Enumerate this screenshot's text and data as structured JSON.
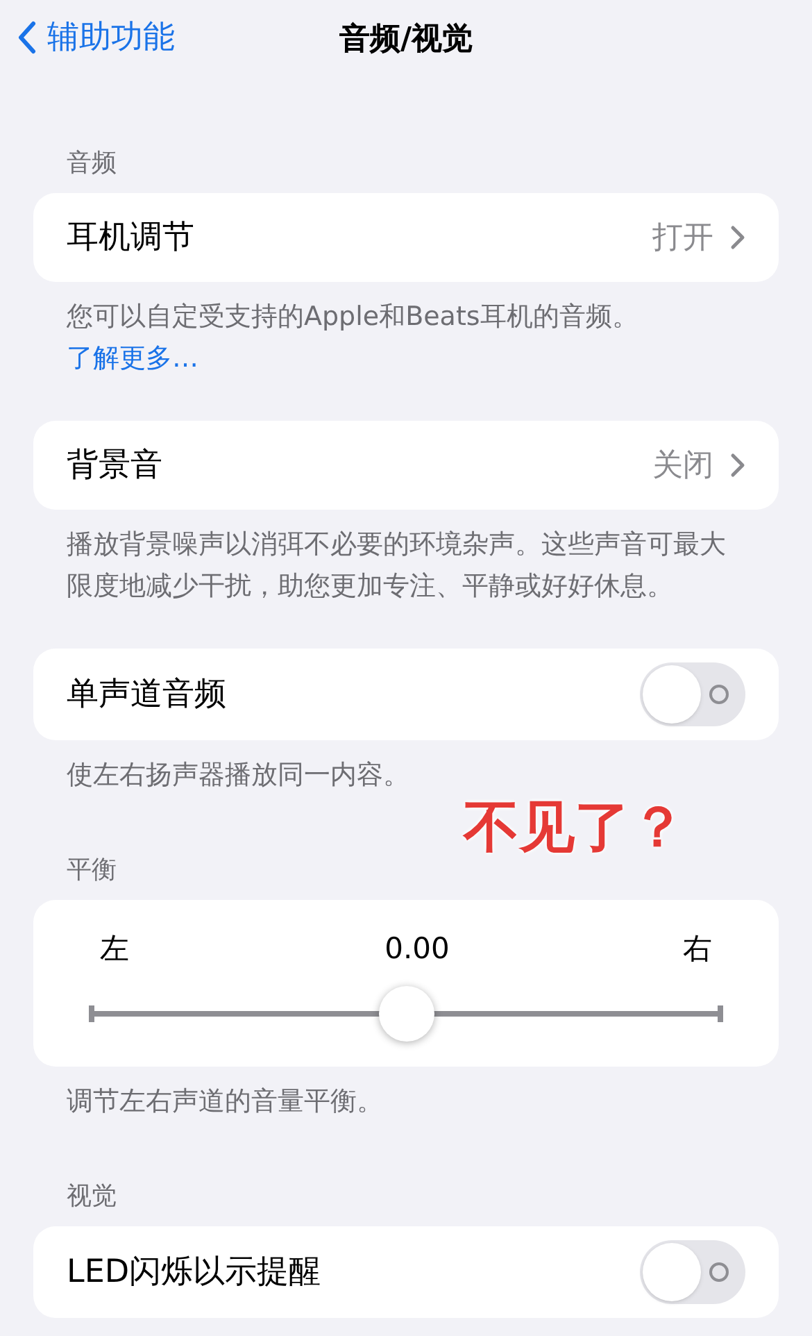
{
  "nav": {
    "back": "辅助功能",
    "title": "音频/视觉"
  },
  "groups": [
    {
      "header": "音频",
      "row": {
        "kind": "link",
        "label": "耳机调节",
        "value": "打开"
      },
      "footer": "您可以自定受支持的Apple和Beats耳机的音频。",
      "footer_link": "了解更多…"
    },
    {
      "row": {
        "kind": "link",
        "label": "背景音",
        "value": "关闭"
      },
      "footer": "播放背景噪声以消弭不必要的环境杂声。这些声音可最大限度地减少干扰，助您更加专注、平静或好好休息。"
    },
    {
      "row": {
        "kind": "toggle",
        "label": "单声道音频",
        "on": false
      },
      "footer": "使左右扬声器播放同一内容。"
    },
    {
      "header": "平衡",
      "row": {
        "kind": "balance",
        "left": "左",
        "reading": "0.00",
        "right": "右",
        "level": 0.5
      },
      "footer": "调节左右声道的音量平衡。"
    },
    {
      "header": "视觉",
      "row": {
        "kind": "toggle",
        "label": "LED闪烁以示提醒",
        "on": false
      }
    }
  ],
  "annotation": {
    "text": "不见了？"
  }
}
